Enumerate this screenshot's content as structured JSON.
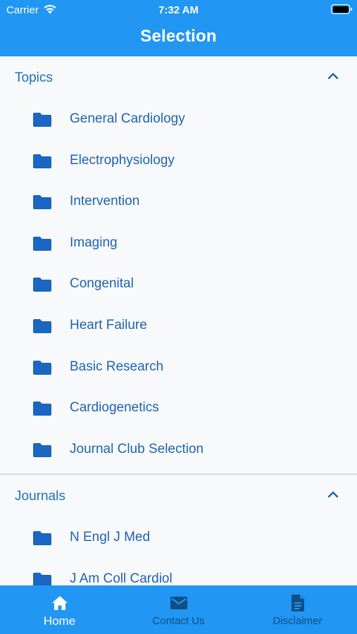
{
  "status_bar": {
    "carrier": "Carrier",
    "time": "7:32 AM"
  },
  "app_bar": {
    "title": "Selection"
  },
  "sections": [
    {
      "title": "Topics",
      "items": [
        "General Cardiology",
        "Electrophysiology",
        "Intervention",
        "Imaging",
        "Congenital",
        "Heart Failure",
        "Basic Research",
        "Cardiogenetics",
        "Journal Club Selection"
      ]
    },
    {
      "title": "Journals",
      "items": [
        "N Engl J Med",
        "J Am Coll Cardiol"
      ]
    }
  ],
  "bottom_nav": {
    "home": "Home",
    "contact": "Contact Us",
    "disclaimer": "Disclaimer"
  },
  "colors": {
    "primary": "#2196f3",
    "accent_text": "#1e63b3",
    "background": "#f8f9fa",
    "inactive_tab": "#0e4f86"
  },
  "icons": {
    "item": "folder-icon",
    "section_toggle": "chevron-up-icon",
    "home": "home-icon",
    "contact": "mail-icon",
    "disclaimer": "document-icon"
  }
}
